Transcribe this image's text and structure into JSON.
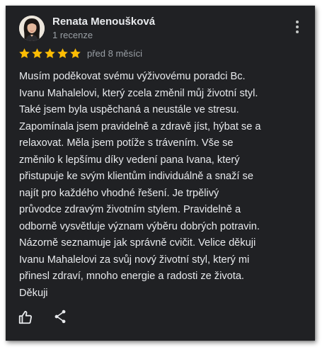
{
  "review": {
    "author_name": "Renata Menoušková",
    "review_count": "1 recenze",
    "rating": 5,
    "rating_max": 5,
    "date": "před 8 měsíci",
    "text_lines": [
      "Musím poděkovat svému výživovému poradci Bc.",
      "Ivanu Mahalelovi, který zcela změnil můj životní styl.",
      "Také jsem byla uspěchaná a neustále ve stresu.",
      "Zapomínala jsem pravidelně a zdravě jíst, hýbat se a",
      "relaxovat. Měla jsem potíže s trávením. Vše se",
      "změnilo k lepšímu díky vedení pana Ivana, který",
      "přistupuje ke svým klientům individuálně a snaží se",
      "najít pro každého vhodné řešení. Je trpělivý",
      "průvodce zdravým životním stylem. Pravidelně a",
      "odborně vysvětluje význam výběru dobrých potravin.",
      "Názorně seznamuje jak správně cvičit. Velice děkuji",
      "Ivanu Mahalelovi za svůj nový životní styl, který mi",
      "přinesl zdraví, mnoho energie a radosti ze života.",
      "Děkuji"
    ]
  },
  "icons": {
    "menu": "more-vert-icon",
    "star": "star-icon",
    "like": "thumb-up-icon",
    "share": "share-icon"
  },
  "colors": {
    "background": "#202124",
    "text_primary": "#e8eaed",
    "text_secondary": "#9aa0a6",
    "star": "#fbbc04"
  }
}
